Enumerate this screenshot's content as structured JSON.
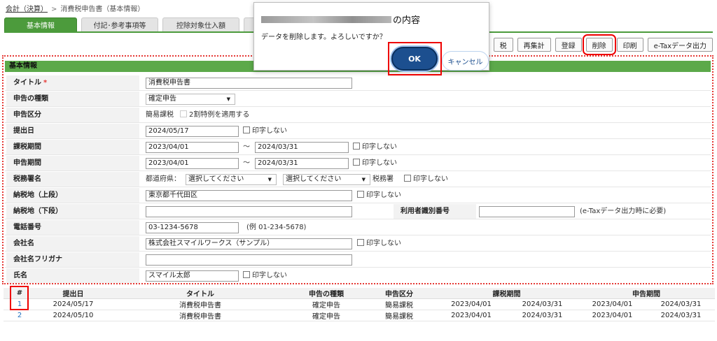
{
  "breadcrumb": {
    "link": "会計（決算）",
    "separator": ">",
    "current": "消費税申告書（基本情報）"
  },
  "tabs": [
    "基本情報",
    "付記･参考事項等",
    "控除対象仕入額",
    ""
  ],
  "toolbar": {
    "b0": "税",
    "b1": "再集計",
    "b2": "登録",
    "b3": "削除",
    "b4": "印刷",
    "b5": "e-Taxデータ出力"
  },
  "panel": {
    "title": "基本情報"
  },
  "form": {
    "title_label": "タイトル",
    "required_mark": "*",
    "title_value": "消費税申告書",
    "kind_label": "申告の種類",
    "kind_value": "確定申告",
    "class_label": "申告区分",
    "class_value": "簡易課税",
    "special_rule": "2割特例を適用する",
    "filed_label": "提出日",
    "filed_value": "2024/05/17",
    "taxperiod_label": "課税期間",
    "taxperiod_from": "2023/04/01",
    "taxperiod_to": "2024/03/31",
    "period_label": "申告期間",
    "period_from": "2023/04/01",
    "period_to": "2024/03/31",
    "tilde": "～",
    "office_label": "税務署名",
    "pref_label": "都道府県：",
    "pref_value": "選択してください",
    "office_value": "選択してください",
    "office_suffix": "税務署",
    "addr1_label": "納税地（上段）",
    "addr1_value": "東京都千代田区",
    "addr2_label": "納税地（下段）",
    "addr2_value": "",
    "userid_label": "利用者識別番号",
    "userid_value": "",
    "userid_note": "(e-Taxデータ出力時に必要)",
    "phone_label": "電話番号",
    "phone_value": "03-1234-5678",
    "phone_hint": "(例 01-234-5678)",
    "company_label": "会社名",
    "company_value": "株式会社スマイルワークス（サンプル）",
    "kana_label": "会社名フリガナ",
    "kana_value": "",
    "name_label": "氏名",
    "name_value": "スマイル太郎",
    "no_print": "印字しない"
  },
  "table": {
    "headers": [
      "#",
      "提出日",
      "タイトル",
      "申告の種類",
      "申告区分",
      "課税期間",
      "申告期間"
    ],
    "rows": [
      [
        "1",
        "2024/05/17",
        "消費税申告書",
        "確定申告",
        "簡易課税",
        "2023/04/01",
        "2024/03/31",
        "2023/04/01",
        "2024/03/31"
      ],
      [
        "2",
        "2024/05/10",
        "消費税申告書",
        "確定申告",
        "簡易課税",
        "2023/04/01",
        "2024/03/31",
        "2023/04/01",
        "2024/03/31"
      ]
    ]
  },
  "dialog": {
    "title_suffix": "の内容",
    "message": "データを削除します。よろしいですか？",
    "ok": "OK",
    "cancel": "キャンセル"
  },
  "colors": {
    "accent_green": "#4c9b3c",
    "ok_blue": "#1c4f8f",
    "highlight_red": "#e00000"
  }
}
